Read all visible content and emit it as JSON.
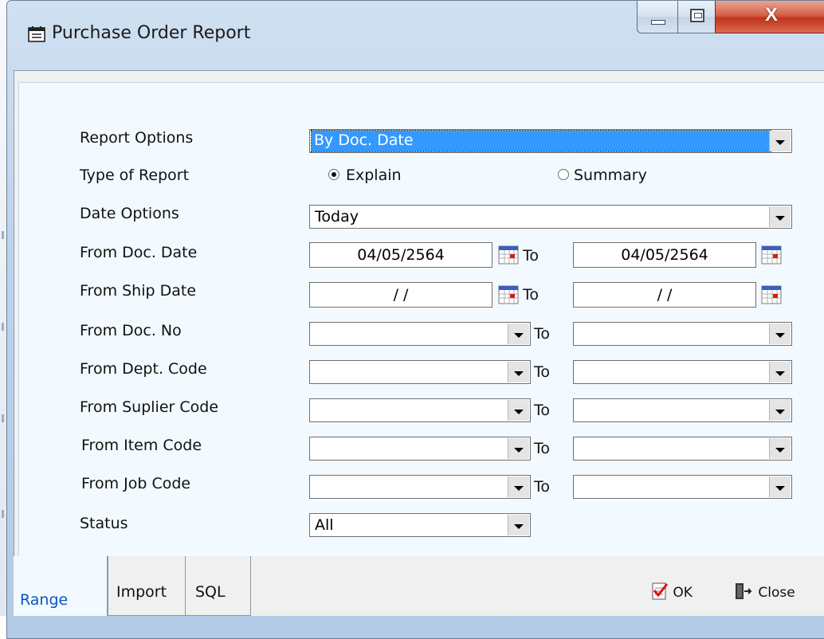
{
  "window": {
    "title": "Purchase Order Report",
    "close_label": "X"
  },
  "form": {
    "report_options": {
      "label": "Report Options",
      "value": "By Doc. Date"
    },
    "type_of_report": {
      "label": "Type of Report",
      "option1": "Explain",
      "option2": "Summary",
      "selected": "Explain"
    },
    "date_options": {
      "label": "Date Options",
      "value": "Today"
    },
    "from_doc_date": {
      "label": "From Doc. Date",
      "from": "04/05/2564",
      "to": "04/05/2564"
    },
    "from_ship_date": {
      "label": "From Ship Date",
      "from": "/ /",
      "to": "/ /"
    },
    "from_doc_no": {
      "label": "From Doc. No",
      "from": "",
      "to": ""
    },
    "from_dept_code": {
      "label": "From Dept. Code",
      "from": "",
      "to": ""
    },
    "from_supplier_code": {
      "label": "From Suplier Code",
      "from": "",
      "to": ""
    },
    "from_item_code": {
      "label": "From Item Code",
      "from": "",
      "to": ""
    },
    "from_job_code": {
      "label": "From Job Code",
      "from": "",
      "to": ""
    },
    "status": {
      "label": "Status",
      "value": "All"
    },
    "to_label": "To"
  },
  "tabs": [
    "Range",
    "Import",
    "SQL"
  ],
  "buttons": {
    "ok": "OK",
    "close": "Close"
  },
  "colors": {
    "selection": "#3399ff",
    "active_tab_text": "#0a55c4"
  }
}
